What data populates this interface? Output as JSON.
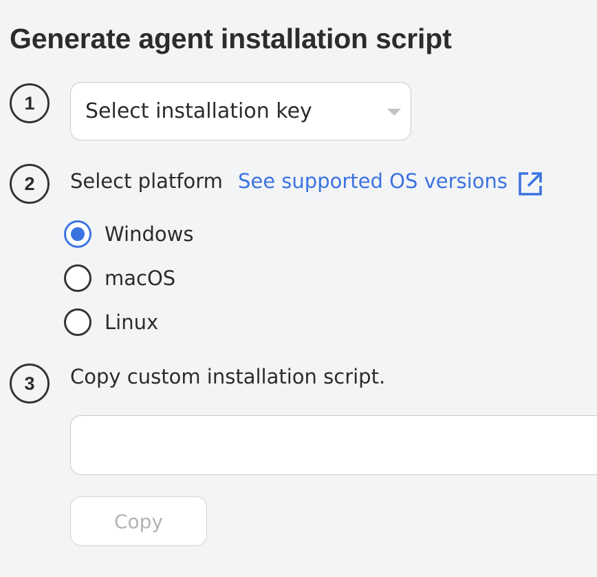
{
  "page": {
    "title": "Generate agent installation script"
  },
  "steps": [
    {
      "number": "1"
    },
    {
      "number": "2"
    },
    {
      "number": "3"
    }
  ],
  "step1": {
    "select_placeholder": "Select installation key",
    "caret_icon": "caret-down-icon"
  },
  "step2": {
    "label": "Select platform",
    "link_text": "See supported OS versions",
    "link_icon": "external-link-icon",
    "options": [
      {
        "label": "Windows",
        "selected": true
      },
      {
        "label": "macOS",
        "selected": false
      },
      {
        "label": "Linux",
        "selected": false
      }
    ]
  },
  "step3": {
    "label": "Copy custom installation script.",
    "script_value": "",
    "copy_label": "Copy",
    "copy_disabled": true
  },
  "colors": {
    "background": "#f3f4f6",
    "accent": "#3b73e0",
    "text": "#2b2b2b",
    "disabled_text": "#b3b3b3",
    "border": "#c9c9c9"
  }
}
